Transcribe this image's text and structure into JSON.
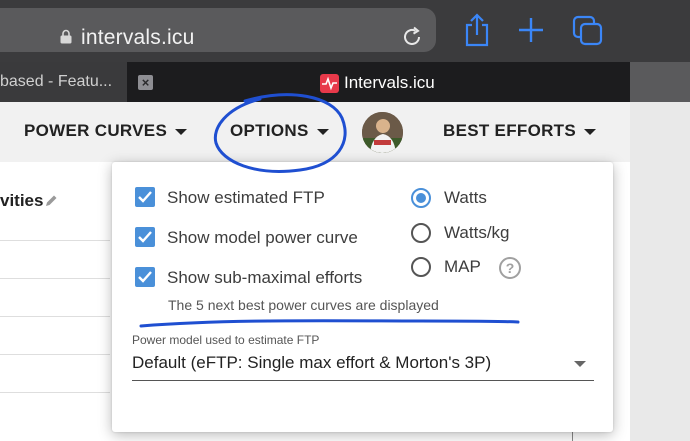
{
  "browser": {
    "url": "intervals.icu",
    "tabs": [
      {
        "title": "based - Featu..."
      },
      {
        "title": "Intervals.icu"
      }
    ]
  },
  "toolbar": {
    "power_curves_label": "POWER CURVES",
    "options_label": "OPTIONS",
    "best_efforts_label": "BEST EFFORTS"
  },
  "background": {
    "section_title": "vities"
  },
  "options_menu": {
    "checkboxes": [
      {
        "label": "Show estimated FTP",
        "checked": true
      },
      {
        "label": "Show model power curve",
        "checked": true
      },
      {
        "label": "Show sub-maximal efforts",
        "checked": true
      }
    ],
    "hint": "The 5 next best power curves are displayed",
    "units": [
      {
        "label": "Watts",
        "selected": true
      },
      {
        "label": "Watts/kg",
        "selected": false
      },
      {
        "label": "MAP",
        "selected": false
      }
    ],
    "help_icon": "?",
    "power_model": {
      "caption": "Power model used to estimate FTP",
      "value": "Default (eFTP: Single max effort & Morton's 3P)"
    }
  },
  "colors": {
    "accent": "#4a90d9",
    "annotation": "#1f4fd1",
    "browser_chrome": "#3b3b3d",
    "ios_blue": "#3b86f7",
    "favicon": "#e8394a"
  }
}
